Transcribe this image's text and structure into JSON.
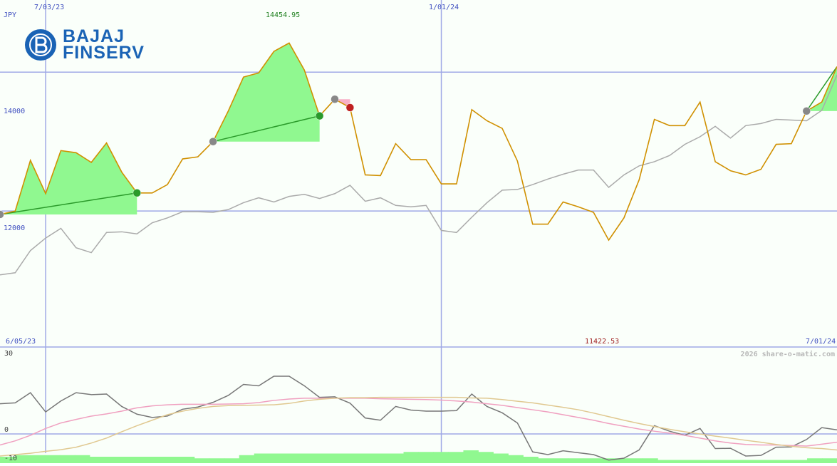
{
  "brand": {
    "logo_line1": "BAJAJ",
    "logo_line2": "FINSERV",
    "color": "#1a63b5"
  },
  "currency": "JPY",
  "watermark": "2026 share-o-matic.com",
  "dates": {
    "top_left": "7/03/23",
    "top_mid": "1/01/24",
    "bottom_left": "6/05/23",
    "bottom_right": "7/01/24"
  },
  "annotations": {
    "high": "14454.95",
    "low": "11422.53"
  },
  "chart_data": [
    {
      "type": "line",
      "name": "price",
      "y_ticks": [
        "14000",
        "12000"
      ],
      "y_tick_values": [
        14000,
        12000
      ],
      "ylim": [
        10040,
        15040
      ],
      "series": [
        {
          "color": "#d09000",
          "values": [
            11950,
            12000,
            12730,
            12250,
            12870,
            12840,
            12700,
            12980,
            12560,
            12260,
            12260,
            12380,
            12750,
            12780,
            13000,
            13440,
            13930,
            13990,
            14300,
            14420,
            14030,
            13370,
            13610,
            13490,
            12520,
            12510,
            12970,
            12740,
            12740,
            12390,
            12390,
            13460,
            13300,
            13190,
            12720,
            11810,
            11810,
            12130,
            12060,
            11980,
            11580,
            11900,
            12450,
            13320,
            13230,
            13230,
            13570,
            12710,
            12580,
            12520,
            12600,
            12960,
            12970,
            13440,
            13570,
            14080
          ]
        },
        {
          "color": "#aaaaaa",
          "values": [
            11080,
            11110,
            11430,
            11610,
            11750,
            11470,
            11400,
            11690,
            11700,
            11670,
            11830,
            11900,
            11990,
            11990,
            11980,
            12020,
            12120,
            12190,
            12130,
            12210,
            12240,
            12180,
            12250,
            12370,
            12140,
            12190,
            12080,
            12060,
            12080,
            11720,
            11690,
            11910,
            12120,
            12300,
            12310,
            12380,
            12460,
            12530,
            12590,
            12590,
            12340,
            12520,
            12650,
            12710,
            12800,
            12960,
            13070,
            13220,
            13050,
            13230,
            13260,
            13320,
            13310,
            13300,
            13450,
            13960
          ]
        }
      ]
    },
    {
      "type": "line",
      "name": "oscillator",
      "y_ticks": [
        "30",
        "0",
        "-10"
      ],
      "y_tick_values": [
        30,
        0,
        -10
      ],
      "ylim": [
        -10.6,
        31.6
      ],
      "series": [
        {
          "color": "#777777",
          "values": [
            11,
            11.3,
            15,
            8,
            12,
            15,
            14.3,
            14.5,
            10,
            7.2,
            6,
            6.5,
            9,
            9.8,
            11.5,
            14,
            18,
            17.5,
            21,
            21,
            17.5,
            13.3,
            13.5,
            11.2,
            5.8,
            5,
            10,
            8.7,
            8.3,
            8.3,
            8.5,
            14.5,
            10,
            7.7,
            4,
            -6.5,
            -7.5,
            -6.1,
            -6.8,
            -7.5,
            -9.5,
            -8.8,
            -5.8,
            3,
            1,
            -0.5,
            2,
            -5.3,
            -5.2,
            -8,
            -7.8,
            -4.8,
            -4.7,
            -2,
            2.3,
            1.5
          ]
        },
        {
          "color": "#f0a0c0",
          "values": [
            -4,
            -2.5,
            -0.5,
            2,
            4,
            5.3,
            6.5,
            7.3,
            8.3,
            9.5,
            10.2,
            10.6,
            10.8,
            10.8,
            10.8,
            10.9,
            11,
            11.4,
            12.2,
            12.7,
            13,
            13,
            13,
            13,
            13,
            12.8,
            12.7,
            12.6,
            12.5,
            12.3,
            12,
            11.6,
            11,
            10.4,
            9.6,
            8.8,
            8,
            7,
            6,
            5,
            3.8,
            2.8,
            1.8,
            1,
            0.3,
            -0.5,
            -1.5,
            -2.5,
            -3.3,
            -3.8,
            -4,
            -4,
            -4.2,
            -4.4,
            -3.7,
            -3
          ]
        },
        {
          "color": "#e0c890",
          "values": [
            -8,
            -7.5,
            -7,
            -6.3,
            -5.7,
            -4.8,
            -3.3,
            -1.5,
            0.8,
            3,
            5,
            7,
            8.3,
            9.3,
            10,
            10.3,
            10.4,
            10.5,
            10.6,
            11.1,
            12,
            12.6,
            13,
            13.2,
            13.2,
            13.3,
            13.3,
            13.3,
            13.3,
            13.3,
            13.3,
            13.1,
            13,
            12.5,
            11.9,
            11.3,
            10.5,
            9.7,
            8.8,
            7.6,
            6.3,
            5,
            3.8,
            2.7,
            1.7,
            0.8,
            0,
            -0.8,
            -1.5,
            -2.3,
            -3,
            -3.8,
            -4.5,
            -5,
            -5.3,
            -5.8
          ]
        }
      ],
      "volume_bars": [
        2,
        2.5,
        2.5,
        2.5,
        2.5,
        2.5,
        2,
        2,
        2,
        2,
        2,
        2,
        2,
        1.5,
        1.5,
        1.5,
        2.5,
        3,
        3,
        3,
        3,
        3,
        3,
        3,
        3,
        3,
        3,
        3.5,
        3.5,
        3.5,
        3.5,
        4,
        3.5,
        3,
        2.5,
        2,
        1.5,
        1.5,
        1.5,
        1.5,
        1.5,
        1.5,
        1.5,
        1.5,
        1,
        1,
        1,
        1,
        1,
        1,
        1,
        1,
        1,
        1,
        1.5,
        1.5
      ]
    }
  ]
}
